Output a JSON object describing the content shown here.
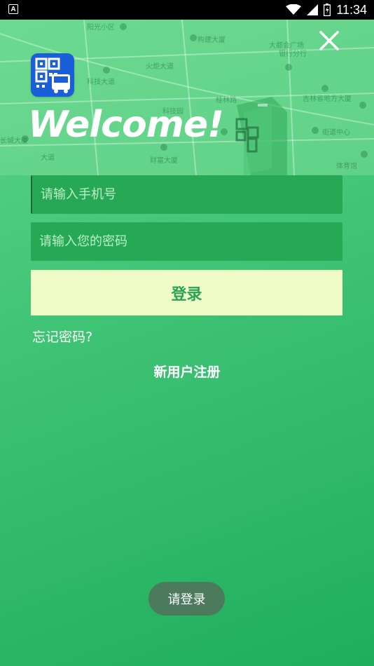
{
  "status_bar": {
    "app_icon_letter": "A",
    "time": "11:34"
  },
  "map_labels": [
    "阳光小区",
    "构建大厦",
    "大都会广场",
    "银行分行",
    "火炬大道",
    "科技大道",
    "吉林省地方大厦",
    "桂林路",
    "科技园",
    "长城大厦",
    "大道",
    "街道中心",
    "财富大厦",
    "体育馆"
  ],
  "header": {
    "welcome": "Welcome!"
  },
  "form": {
    "phone_placeholder": "请输入手机号",
    "password_placeholder": "请输入您的密码",
    "login_label": "登录",
    "forgot_label": "忘记密码?",
    "register_label": "新用户注册"
  },
  "toast": {
    "message": "请登录"
  },
  "colors": {
    "accent": "#2ca257",
    "input_bg": "#27a854",
    "button_bg": "#effbc6",
    "logo_bg": "#1a5fd8"
  },
  "icons": {
    "close": "close-icon",
    "logo": "qr-bus-logo-icon",
    "wifi": "wifi-icon",
    "signal": "signal-icon",
    "battery": "battery-icon"
  }
}
